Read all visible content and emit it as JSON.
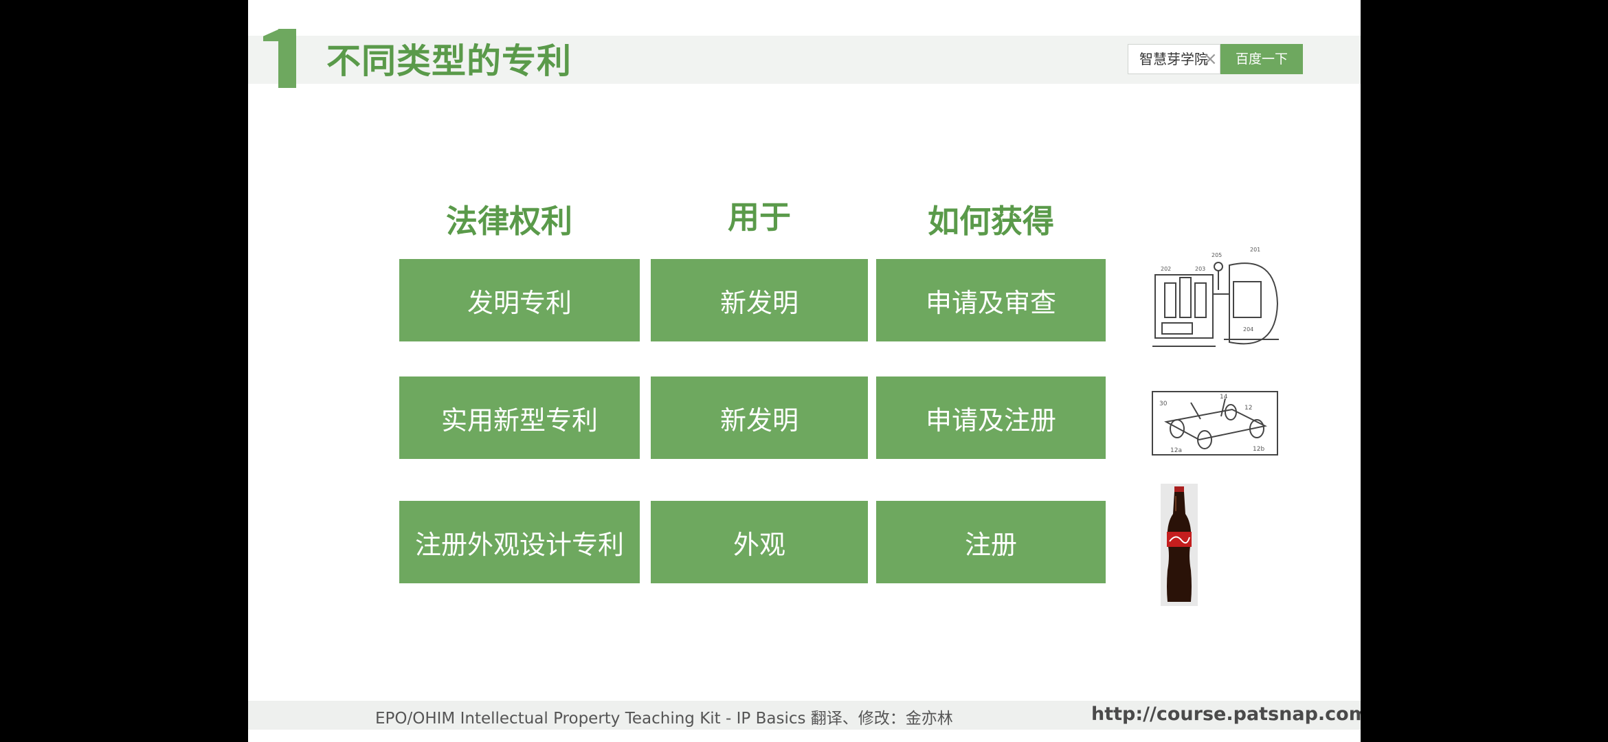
{
  "slide": {
    "title": "不同类型的专利",
    "search": {
      "value": "智慧芽学院",
      "button_label": "百度一下"
    },
    "table": {
      "headers": [
        "法律权利",
        "用于",
        "如何获得"
      ],
      "rows": [
        [
          "发明专利",
          "新发明",
          "申请及审查"
        ],
        [
          "实用新型专利",
          "新发明",
          "申请及注册"
        ],
        [
          "注册外观设计专利",
          "外观",
          "注册"
        ]
      ]
    },
    "footer": {
      "left": "EPO/OHIM      Intellectual Property Teaching Kit - IP Basics 翻译、修改：金亦林",
      "right": "http://course.patsnap.com/"
    }
  },
  "colors": {
    "accent": "#6ea85f",
    "title": "#5a9a4a"
  },
  "icons": [
    "close-icon",
    "patent-drawing-icon",
    "utility-model-drawing-icon",
    "bottle-image"
  ]
}
